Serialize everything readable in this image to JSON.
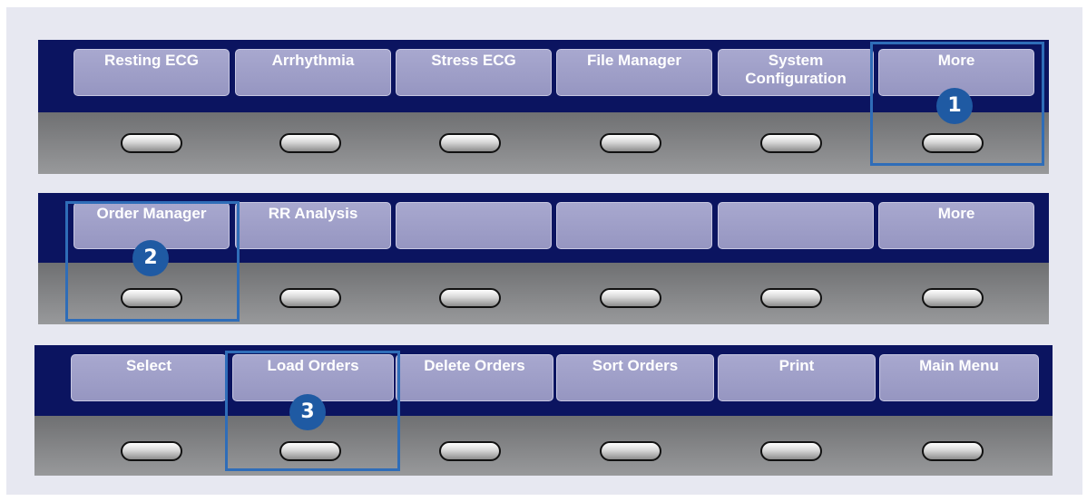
{
  "rows": [
    {
      "keys": [
        {
          "lines": [
            "Resting ECG"
          ]
        },
        {
          "lines": [
            "Arrhythmia"
          ]
        },
        {
          "lines": [
            "Stress ECG"
          ]
        },
        {
          "lines": [
            "File Manager"
          ]
        },
        {
          "lines": [
            "System",
            "Configuration"
          ]
        },
        {
          "lines": [
            "More"
          ]
        }
      ]
    },
    {
      "keys": [
        {
          "lines": [
            "Order Manager"
          ]
        },
        {
          "lines": [
            "RR Analysis"
          ]
        },
        {
          "lines": [
            ""
          ]
        },
        {
          "lines": [
            ""
          ]
        },
        {
          "lines": [
            ""
          ]
        },
        {
          "lines": [
            "More"
          ]
        }
      ]
    },
    {
      "keys": [
        {
          "lines": [
            "Select"
          ]
        },
        {
          "lines": [
            "Load Orders"
          ]
        },
        {
          "lines": [
            "Delete Orders"
          ]
        },
        {
          "lines": [
            "Sort Orders"
          ]
        },
        {
          "lines": [
            "Print"
          ]
        },
        {
          "lines": [
            "Main Menu"
          ]
        }
      ]
    }
  ],
  "callouts": [
    "1",
    "2",
    "3"
  ],
  "colors": {
    "panel": "#0b1460",
    "key": "#9999c4",
    "highlight": "#2f6db8",
    "badge": "#1f5aa3"
  }
}
